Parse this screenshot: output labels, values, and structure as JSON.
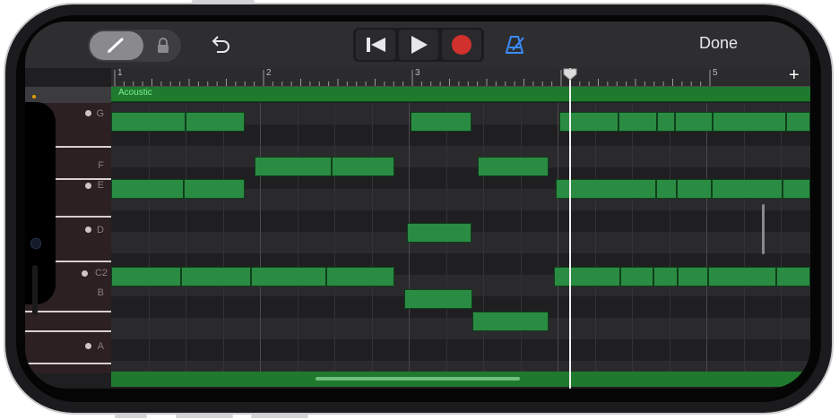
{
  "toolbar": {
    "pencil_icon": "pencil-icon",
    "lock_icon": "lock-icon",
    "undo_icon": "undo-icon",
    "rewind_icon": "rewind-icon",
    "play_icon": "play-icon",
    "record_icon": "record-icon",
    "metronome_icon": "metronome-icon",
    "done_label": "Done",
    "record_color": "#d0312d",
    "metronome_color": "#3b8cff"
  },
  "ruler": {
    "bars": [
      "1",
      "2",
      "3",
      "4",
      "5"
    ],
    "add_label": "+"
  },
  "track": {
    "region_label": "Acoustic",
    "region_color": "#1f7a2e",
    "note_color": "#2a8c43"
  },
  "keys": [
    {
      "label": "G",
      "marker": true
    },
    {
      "label": "F",
      "marker": false
    },
    {
      "label": "E",
      "marker": true
    },
    {
      "label": "D",
      "marker": true
    },
    {
      "label": "C2",
      "marker": true
    },
    {
      "label": "B",
      "marker": false
    },
    {
      "label": "A",
      "marker": true
    }
  ],
  "playhead_bar": 4.0
}
